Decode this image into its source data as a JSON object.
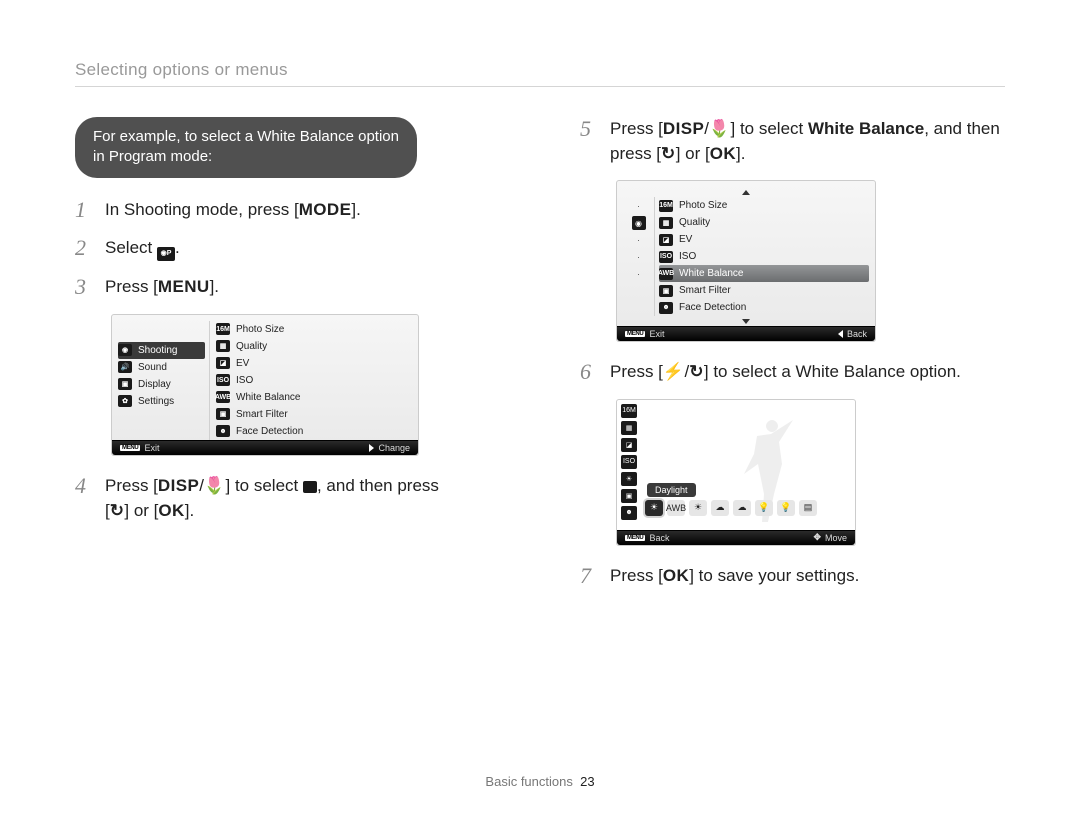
{
  "header": {
    "title": "Selecting options or menus"
  },
  "pill": {
    "line1": "For example, to select a White Balance option",
    "line2": "in Program mode:"
  },
  "steps": {
    "s1": {
      "num": "1",
      "text_a": "In Shooting mode, press [",
      "btn": "MODE",
      "text_b": "]."
    },
    "s2": {
      "num": "2",
      "text": "Select ",
      "icon_name": "program-mode-icon",
      "tail": "."
    },
    "s3": {
      "num": "3",
      "text_a": "Press [",
      "btn": "MENU",
      "text_b": "]."
    },
    "s4": {
      "num": "4",
      "text_a": "Press [",
      "btn1": "DISP",
      "sep": "/",
      "btn2": "macro",
      "text_b": "] to select ",
      "icon_name": "camera-icon",
      "text_c": ", and then press",
      "line2_a": "[",
      "btn3": "timer",
      "line2_b": "] or [",
      "btn4": "OK",
      "line2_c": "]."
    },
    "s5": {
      "num": "5",
      "text_a": "Press [",
      "btn1": "DISP",
      "sep": "/",
      "btn2": "macro",
      "text_b": "] to select ",
      "bold": "White Balance",
      "text_c": ", and then",
      "line2_a": "press [",
      "btn3": "timer",
      "line2_b": "] or [",
      "btn4": "OK",
      "line2_c": "]."
    },
    "s6": {
      "num": "6",
      "text_a": "Press [",
      "btn1": "flash",
      "sep": "/",
      "btn2": "timer",
      "text_b": "] to select a White Balance option."
    },
    "s7": {
      "num": "7",
      "text_a": "Press [",
      "btn": "OK",
      "text_b": "] to save your settings."
    }
  },
  "screenshot3": {
    "left": [
      "Shooting",
      "Sound",
      "Display",
      "Settings"
    ],
    "right": [
      "Photo Size",
      "Quality",
      "EV",
      "ISO",
      "White Balance",
      "Smart Filter",
      "Face Detection"
    ],
    "footer_left": "Exit",
    "footer_right": "Change",
    "menu_tag": "MENU"
  },
  "screenshot5": {
    "right": [
      "Photo Size",
      "Quality",
      "EV",
      "ISO",
      "White Balance",
      "Smart Filter",
      "Face Detection"
    ],
    "footer_left": "Exit",
    "footer_right": "Back",
    "menu_tag": "MENU"
  },
  "screenshot6": {
    "selected_label": "Daylight",
    "options": [
      "☀",
      "AWB",
      "☀",
      "☁",
      "☁",
      "💡",
      "💡",
      "▤"
    ],
    "footer_left": "Back",
    "footer_right": "Move",
    "menu_tag": "MENU"
  },
  "footer": {
    "section": "Basic functions",
    "page": "23"
  }
}
